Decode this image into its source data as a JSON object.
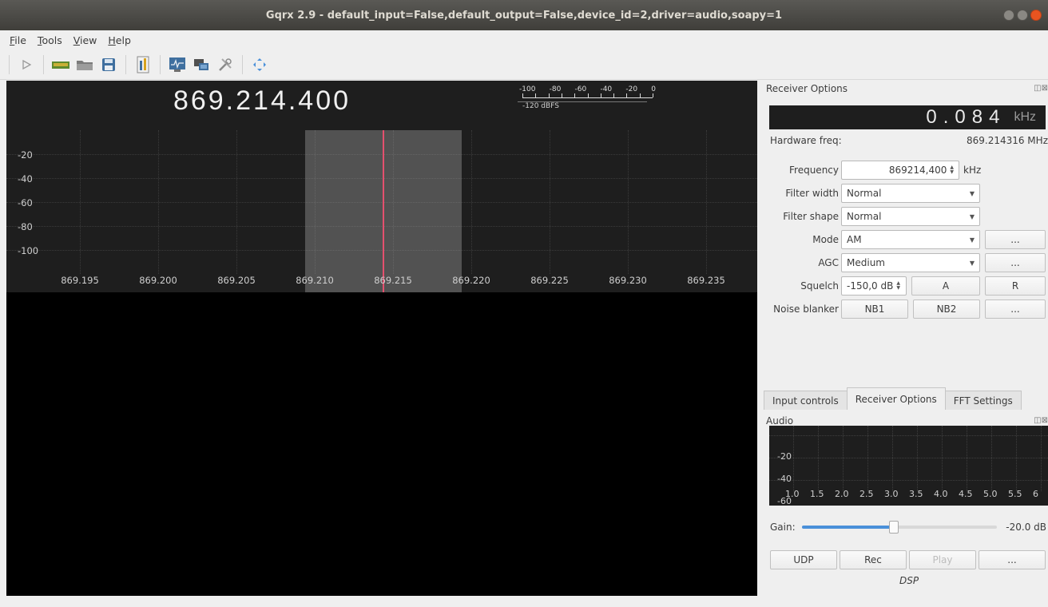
{
  "window": {
    "title": "Gqrx 2.9 - default_input=False,default_output=False,device_id=2,driver=audio,soapy=1"
  },
  "menu": [
    "File",
    "Tools",
    "View",
    "Help"
  ],
  "toolbar": [
    "play-icon",
    "device-icon",
    "open-icon",
    "save-icon",
    "record-icon",
    "spectrum-icon",
    "remote-icon",
    "settings-icon",
    "fullscreen-icon"
  ],
  "plotter": {
    "frequency": "869.214.400",
    "meter_ticks": [
      "-100",
      "-80",
      "-60",
      "-40",
      "-20",
      "0"
    ],
    "meter_label": "-120 dBFS",
    "y_labels": [
      "-20",
      "-40",
      "-60",
      "-80",
      "-100"
    ],
    "x_labels": [
      "869.195",
      "869.200",
      "869.205",
      "869.210",
      "869.215",
      "869.220",
      "869.225",
      "869.230",
      "869.235"
    ]
  },
  "receiver": {
    "title": "Receiver Options",
    "offset_display": "0.084",
    "offset_unit": "kHz",
    "hw_label": "Hardware freq:",
    "hw_value": "869.214316 MHz",
    "frequency_label": "Frequency",
    "frequency_value": "869214,400",
    "frequency_unit": "kHz",
    "filter_width_label": "Filter width",
    "filter_width_value": "Normal",
    "filter_shape_label": "Filter shape",
    "filter_shape_value": "Normal",
    "mode_label": "Mode",
    "mode_value": "AM",
    "agc_label": "AGC",
    "agc_value": "Medium",
    "squelch_label": "Squelch",
    "squelch_value": "-150,0 dB",
    "nb_label": "Noise blanker",
    "more": "...",
    "a": "A",
    "r": "R",
    "nb1": "NB1",
    "nb2": "NB2"
  },
  "tabs": [
    "Input controls",
    "Receiver Options",
    "FFT Settings"
  ],
  "audio": {
    "title": "Audio",
    "y_labels": [
      "-20",
      "-40",
      "-60"
    ],
    "x_labels": [
      "1.0",
      "1.5",
      "2.0",
      "2.5",
      "3.0",
      "3.5",
      "4.0",
      "4.5",
      "5.0",
      "5.5",
      "6"
    ],
    "gain_label": "Gain:",
    "gain_value": "-20.0 dB",
    "gain_level": 0.47,
    "udp": "UDP",
    "rec": "Rec",
    "play": "Play",
    "more": "...",
    "dsp": "DSP"
  },
  "colors": {
    "accent": "#4a90d9",
    "marker": "#e4506e",
    "close": "#e95420"
  }
}
